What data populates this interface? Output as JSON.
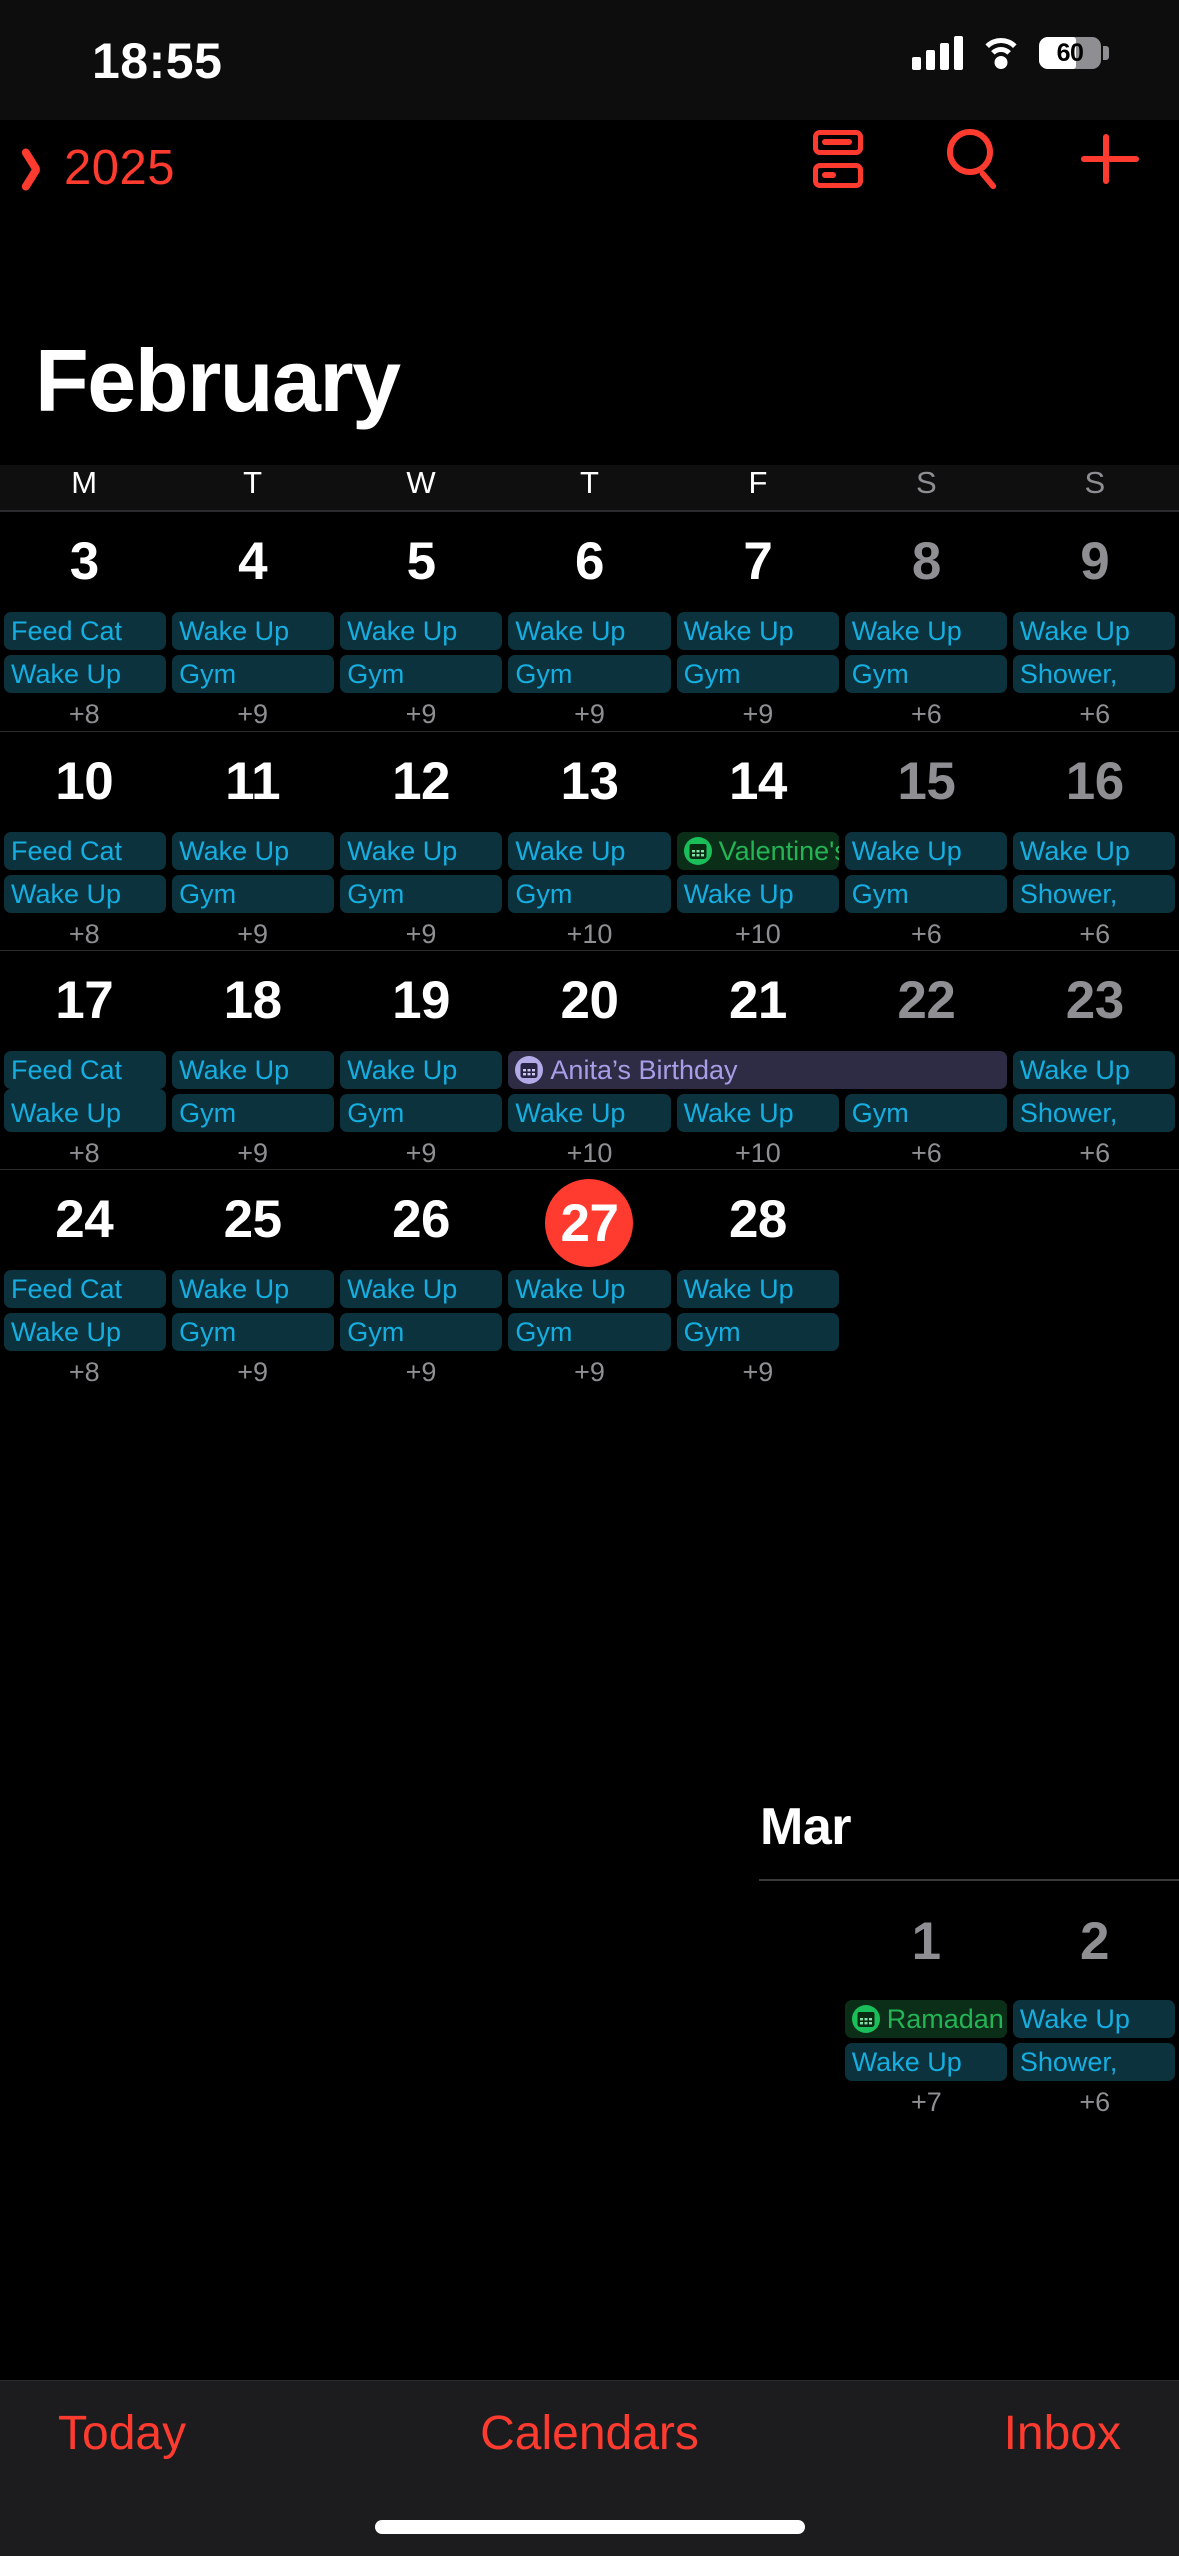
{
  "status_bar": {
    "time": "18:55",
    "battery_level": "60",
    "battery_percent": 60,
    "icons": [
      "cellular-signal-icon",
      "wifi-icon",
      "battery-icon"
    ]
  },
  "nav_bar": {
    "back_label": "2025",
    "back_icon": "chevron-left-icon",
    "actions": [
      {
        "name": "list-view-icon",
        "label": "List View"
      },
      {
        "name": "search-icon",
        "label": "Search"
      },
      {
        "name": "add-event-icon",
        "label": "Add Event"
      }
    ],
    "accent_color": "#FF3B30"
  },
  "month": {
    "title": "February",
    "weekday_headers": [
      "M",
      "T",
      "W",
      "T",
      "F",
      "S",
      "S"
    ],
    "weekend_indices": [
      5,
      6
    ]
  },
  "colors": {
    "accent": "#FF3B30",
    "event_blue_text": "#16AEE0",
    "event_blue_bg": "#0B323D",
    "event_green_text": "#24B455",
    "event_green_bg": "#0B2E19",
    "event_purple_text": "#A79EE8",
    "event_purple_bg": "#2E2B44",
    "weekend_text": "#8E8E93",
    "background": "#000000"
  },
  "weeks": [
    {
      "days": [
        {
          "num": "3",
          "weekend": false,
          "today": false
        },
        {
          "num": "4",
          "weekend": false,
          "today": false
        },
        {
          "num": "5",
          "weekend": false,
          "today": false
        },
        {
          "num": "6",
          "weekend": false,
          "today": false
        },
        {
          "num": "7",
          "weekend": false,
          "today": false
        },
        {
          "num": "8",
          "weekend": true,
          "today": false
        },
        {
          "num": "9",
          "weekend": true,
          "today": false
        }
      ],
      "row1": [
        {
          "label": "Feed Cat",
          "color": "blue"
        },
        {
          "label": "Wake Up",
          "color": "blue"
        },
        {
          "label": "Wake Up",
          "color": "blue"
        },
        {
          "label": "Wake Up",
          "color": "blue"
        },
        {
          "label": "Wake Up",
          "color": "blue"
        },
        {
          "label": "Wake Up",
          "color": "blue"
        },
        {
          "label": "Wake Up",
          "color": "blue"
        }
      ],
      "row2": [
        {
          "label": "Wake Up",
          "color": "blue"
        },
        {
          "label": "Gym",
          "color": "blue"
        },
        {
          "label": "Gym",
          "color": "blue"
        },
        {
          "label": "Gym",
          "color": "blue"
        },
        {
          "label": "Gym",
          "color": "blue"
        },
        {
          "label": "Gym",
          "color": "blue"
        },
        {
          "label": "Shower,",
          "color": "blue"
        }
      ],
      "counts": [
        "+8",
        "+9",
        "+9",
        "+9",
        "+9",
        "+6",
        "+6"
      ]
    },
    {
      "days": [
        {
          "num": "10",
          "weekend": false,
          "today": false
        },
        {
          "num": "11",
          "weekend": false,
          "today": false
        },
        {
          "num": "12",
          "weekend": false,
          "today": false
        },
        {
          "num": "13",
          "weekend": false,
          "today": false
        },
        {
          "num": "14",
          "weekend": false,
          "today": false
        },
        {
          "num": "15",
          "weekend": true,
          "today": false
        },
        {
          "num": "16",
          "weekend": true,
          "today": false
        }
      ],
      "row1": [
        {
          "label": "Feed Cat",
          "color": "blue"
        },
        {
          "label": "Wake Up",
          "color": "blue"
        },
        {
          "label": "Wake Up",
          "color": "blue"
        },
        {
          "label": "Wake Up",
          "color": "blue"
        },
        {
          "label": "Valentine's Day",
          "color": "green",
          "icon": "calendar-badge-icon"
        },
        {
          "label": "Wake Up",
          "color": "blue"
        },
        {
          "label": "Wake Up",
          "color": "blue"
        }
      ],
      "row2": [
        {
          "label": "Wake Up",
          "color": "blue"
        },
        {
          "label": "Gym",
          "color": "blue"
        },
        {
          "label": "Gym",
          "color": "blue"
        },
        {
          "label": "Gym",
          "color": "blue"
        },
        {
          "label": "Wake Up",
          "color": "blue"
        },
        {
          "label": "Gym",
          "color": "blue"
        },
        {
          "label": "Shower,",
          "color": "blue"
        }
      ],
      "counts": [
        "+8",
        "+9",
        "+9",
        "+10",
        "+10",
        "+6",
        "+6"
      ]
    },
    {
      "days": [
        {
          "num": "17",
          "weekend": false,
          "today": false
        },
        {
          "num": "18",
          "weekend": false,
          "today": false
        },
        {
          "num": "19",
          "weekend": false,
          "today": false
        },
        {
          "num": "20",
          "weekend": false,
          "today": false
        },
        {
          "num": "21",
          "weekend": false,
          "today": false
        },
        {
          "num": "22",
          "weekend": true,
          "today": false
        },
        {
          "num": "23",
          "weekend": true,
          "today": false
        }
      ],
      "row1": [
        {
          "label": "Feed Cat",
          "color": "blue"
        },
        {
          "label": "Wake Up",
          "color": "blue"
        },
        {
          "label": "Wake Up",
          "color": "blue"
        },
        {
          "label": "Anita’s Birthday",
          "color": "purple",
          "icon": "calendar-badge-icon",
          "span": 2
        },
        {
          "label": "Wake Up",
          "color": "blue"
        },
        {
          "label": "Wake Up",
          "color": "blue"
        }
      ],
      "row2": [
        {
          "label": "Wake Up",
          "color": "blue"
        },
        {
          "label": "Gym",
          "color": "blue"
        },
        {
          "label": "Gym",
          "color": "blue"
        },
        {
          "label": "Wake Up",
          "color": "blue"
        },
        {
          "label": "Wake Up",
          "color": "blue"
        },
        {
          "label": "Gym",
          "color": "blue"
        },
        {
          "label": "Shower,",
          "color": "blue"
        }
      ],
      "counts": [
        "+8",
        "+9",
        "+9",
        "+10",
        "+10",
        "+6",
        "+6"
      ]
    },
    {
      "days": [
        {
          "num": "24",
          "weekend": false,
          "today": false
        },
        {
          "num": "25",
          "weekend": false,
          "today": false
        },
        {
          "num": "26",
          "weekend": false,
          "today": false
        },
        {
          "num": "27",
          "weekend": false,
          "today": true
        },
        {
          "num": "28",
          "weekend": false,
          "today": false
        },
        {
          "num": "",
          "weekend": true,
          "today": false
        },
        {
          "num": "",
          "weekend": true,
          "today": false
        }
      ],
      "row1": [
        {
          "label": "Feed Cat",
          "color": "blue"
        },
        {
          "label": "Wake Up",
          "color": "blue"
        },
        {
          "label": "Wake Up",
          "color": "blue"
        },
        {
          "label": "Wake Up",
          "color": "blue"
        },
        {
          "label": "Wake Up",
          "color": "blue"
        },
        {
          "label": "",
          "color": "empty"
        },
        {
          "label": "",
          "color": "empty"
        }
      ],
      "row2": [
        {
          "label": "Wake Up",
          "color": "blue"
        },
        {
          "label": "Gym",
          "color": "blue"
        },
        {
          "label": "Gym",
          "color": "blue"
        },
        {
          "label": "Gym",
          "color": "blue"
        },
        {
          "label": "Gym",
          "color": "blue"
        },
        {
          "label": "",
          "color": "empty"
        },
        {
          "label": "",
          "color": "empty"
        }
      ],
      "counts": [
        "+8",
        "+9",
        "+9",
        "+9",
        "+9",
        "",
        ""
      ]
    }
  ],
  "next_month": {
    "label": "Mar",
    "days": [
      "",
      "",
      "",
      "",
      "",
      "1",
      "2"
    ],
    "row1": [
      {
        "label": "",
        "color": "empty"
      },
      {
        "label": "",
        "color": "empty"
      },
      {
        "label": "",
        "color": "empty"
      },
      {
        "label": "",
        "color": "empty"
      },
      {
        "label": "",
        "color": "empty"
      },
      {
        "label": "Ramadan",
        "color": "green",
        "icon": "calendar-badge-icon"
      },
      {
        "label": "Wake Up",
        "color": "blue"
      }
    ],
    "row2": [
      {
        "label": "",
        "color": "empty"
      },
      {
        "label": "",
        "color": "empty"
      },
      {
        "label": "",
        "color": "empty"
      },
      {
        "label": "",
        "color": "empty"
      },
      {
        "label": "",
        "color": "empty"
      },
      {
        "label": "Wake Up",
        "color": "blue"
      },
      {
        "label": "Shower,",
        "color": "blue"
      }
    ],
    "counts": [
      "",
      "",
      "",
      "",
      "",
      "+7",
      "+6"
    ]
  },
  "toolbar": {
    "today_label": "Today",
    "calendars_label": "Calendars",
    "inbox_label": "Inbox"
  }
}
